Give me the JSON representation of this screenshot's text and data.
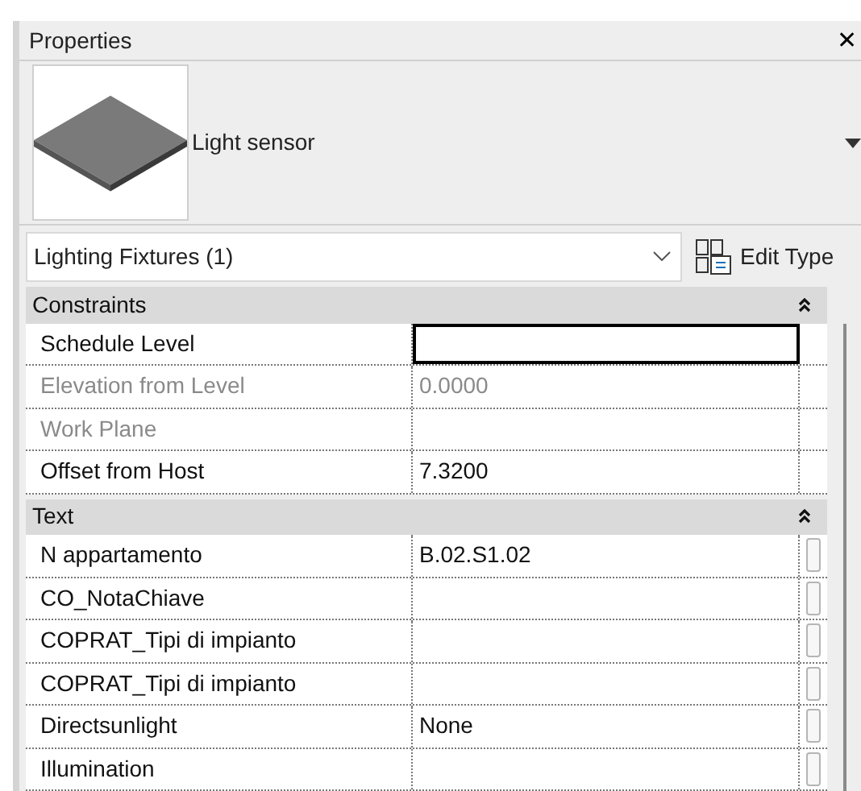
{
  "window": {
    "title": "Properties",
    "close": "✕"
  },
  "type_selector": {
    "name": "Light sensor"
  },
  "filter": {
    "value": "Lighting Fixtures (1)",
    "edit_type": "Edit Type"
  },
  "groups": [
    {
      "title": "Constraints",
      "expanded": true,
      "rows": [
        {
          "name": "Schedule Level",
          "value": "",
          "disabled": false,
          "focused": true,
          "button": false
        },
        {
          "name": "Elevation from Level",
          "value": "0.0000",
          "disabled": true,
          "focused": false,
          "button": false
        },
        {
          "name": "Work Plane",
          "value": "",
          "disabled": true,
          "focused": false,
          "button": false
        },
        {
          "name": "Offset from Host",
          "value": "7.3200",
          "disabled": false,
          "focused": false,
          "button": false
        }
      ]
    },
    {
      "title": "Text",
      "expanded": true,
      "rows": [
        {
          "name": "N appartamento",
          "value": "B.02.S1.02",
          "disabled": false,
          "focused": false,
          "button": true
        },
        {
          "name": "CO_NotaChiave",
          "value": "",
          "disabled": false,
          "focused": false,
          "button": true
        },
        {
          "name": "COPRAT_Tipi di impianto",
          "value": "",
          "disabled": false,
          "focused": false,
          "button": true
        },
        {
          "name": "COPRAT_Tipi di impianto",
          "value": "",
          "disabled": false,
          "focused": false,
          "button": true
        },
        {
          "name": "Directsunlight",
          "value": "None",
          "disabled": false,
          "focused": false,
          "button": true
        },
        {
          "name": "Illumination",
          "value": "",
          "disabled": false,
          "focused": false,
          "button": true
        }
      ]
    }
  ]
}
